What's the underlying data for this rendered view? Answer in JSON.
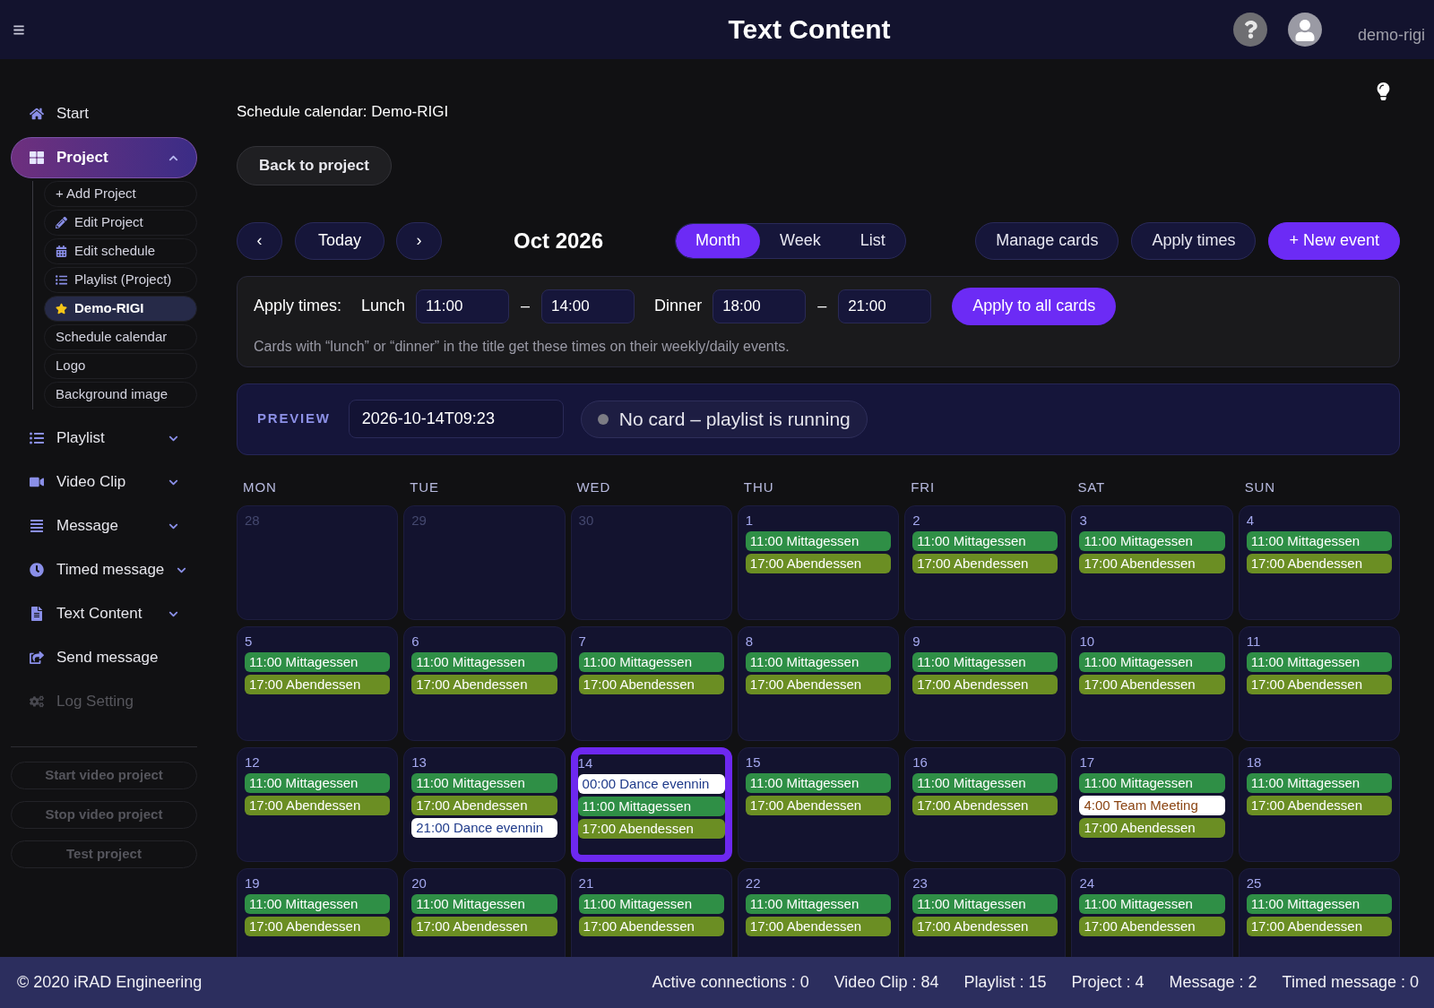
{
  "header": {
    "title": "Text Content",
    "username": "demo-rigi"
  },
  "sidebar": {
    "items": [
      {
        "label": "Start",
        "kind": "link",
        "selected": false,
        "disabled": false
      },
      {
        "label": "Project",
        "kind": "group",
        "selected": true,
        "expanded": true,
        "disabled": false,
        "children": [
          {
            "label": "+ Add Project",
            "selected": false
          },
          {
            "label": "Edit Project",
            "selected": false
          },
          {
            "label": "Edit schedule",
            "selected": false
          },
          {
            "label": "Playlist (Project)",
            "selected": false
          },
          {
            "label": "Demo-RIGI",
            "selected": true
          },
          {
            "label": "Schedule calendar",
            "selected": false
          },
          {
            "label": "Logo",
            "selected": false
          },
          {
            "label": "Background image",
            "selected": false
          }
        ]
      },
      {
        "label": "Playlist",
        "kind": "group",
        "selected": false,
        "expanded": false,
        "disabled": false
      },
      {
        "label": "Video Clip",
        "kind": "group",
        "selected": false,
        "expanded": false,
        "disabled": false
      },
      {
        "label": "Message",
        "kind": "group",
        "selected": false,
        "expanded": false,
        "disabled": false
      },
      {
        "label": "Timed message",
        "kind": "group",
        "selected": false,
        "expanded": false,
        "disabled": false
      },
      {
        "label": "Text Content",
        "kind": "group",
        "selected": false,
        "expanded": false,
        "disabled": false
      },
      {
        "label": "Send message",
        "kind": "link",
        "selected": false,
        "disabled": false
      },
      {
        "label": "Log Setting",
        "kind": "link",
        "selected": false,
        "disabled": true
      }
    ],
    "actions": [
      {
        "label": "Start video project",
        "disabled": true
      },
      {
        "label": "Stop video project",
        "disabled": true
      },
      {
        "label": "Test project",
        "disabled": true
      }
    ]
  },
  "breadcrumb": "Schedule calendar: Demo-RIGI",
  "back_button": "Back to project",
  "toolbar": {
    "prev": "‹",
    "today": "Today",
    "next": "›",
    "period": "Oct 2026",
    "views": [
      {
        "label": "Month",
        "selected": true
      },
      {
        "label": "Week",
        "selected": false
      },
      {
        "label": "List",
        "selected": false
      }
    ],
    "buttons": [
      {
        "label": "Manage cards",
        "kind": "secondary"
      },
      {
        "label": "Apply times",
        "kind": "secondary"
      },
      {
        "label": "+ New event",
        "kind": "primary"
      }
    ]
  },
  "apply_times": {
    "label": "Apply times:",
    "groups": [
      {
        "label": "Lunch",
        "from": "11:00",
        "separator": "–",
        "to": "14:00"
      },
      {
        "label": "Dinner",
        "from": "18:00",
        "separator": "–",
        "to": "21:00"
      }
    ],
    "button": "Apply to all cards",
    "note": "Cards with “lunch” or “dinner” in the title get these times on their weekly/daily events."
  },
  "preview": {
    "label": "PREVIEW",
    "datetime": "2026-10-14T09:23",
    "status": "No card – playlist is running"
  },
  "calendar": {
    "weekdays": [
      "MON",
      "TUE",
      "WED",
      "THU",
      "FRI",
      "SAT",
      "SUN"
    ],
    "weeks": [
      {
        "days": [
          {
            "date": "28",
            "outside_month": true,
            "today": false
          },
          {
            "date": "29",
            "outside_month": true,
            "today": false
          },
          {
            "date": "30",
            "outside_month": true,
            "today": false
          },
          {
            "date": "1",
            "outside_month": false,
            "today": false,
            "events": [
              {
                "label": "11:00 Mittagessen",
                "kind": "filled",
                "color": "#2f8f46"
              },
              {
                "label": "17:00 Abendessen",
                "kind": "filled",
                "color": "#6b8e23"
              }
            ]
          },
          {
            "date": "2",
            "outside_month": false,
            "today": false,
            "events": [
              {
                "label": "11:00 Mittagessen",
                "kind": "filled",
                "color": "#2f8f46"
              },
              {
                "label": "17:00 Abendessen",
                "kind": "filled",
                "color": "#6b8e23"
              }
            ]
          },
          {
            "date": "3",
            "outside_month": false,
            "today": false,
            "events": [
              {
                "label": "11:00 Mittagessen",
                "kind": "filled",
                "color": "#2f8f46"
              },
              {
                "label": "17:00 Abendessen",
                "kind": "filled",
                "color": "#6b8e23"
              }
            ]
          },
          {
            "date": "4",
            "outside_month": false,
            "today": false,
            "events": [
              {
                "label": "11:00 Mittagessen",
                "kind": "filled",
                "color": "#2f8f46"
              },
              {
                "label": "17:00 Abendessen",
                "kind": "filled",
                "color": "#6b8e23"
              }
            ]
          }
        ]
      },
      {
        "days": [
          {
            "date": "5",
            "outside_month": false,
            "today": false,
            "events": [
              {
                "label": "11:00 Mittagessen",
                "kind": "filled",
                "color": "#2f8f46"
              },
              {
                "label": "17:00 Abendessen",
                "kind": "filled",
                "color": "#6b8e23"
              }
            ]
          },
          {
            "date": "6",
            "outside_month": false,
            "today": false,
            "events": [
              {
                "label": "11:00 Mittagessen",
                "kind": "filled",
                "color": "#2f8f46"
              },
              {
                "label": "17:00 Abendessen",
                "kind": "filled",
                "color": "#6b8e23"
              }
            ]
          },
          {
            "date": "7",
            "outside_month": false,
            "today": false,
            "events": [
              {
                "label": "11:00 Mittagessen",
                "kind": "filled",
                "color": "#2f8f46"
              },
              {
                "label": "17:00 Abendessen",
                "kind": "filled",
                "color": "#6b8e23"
              }
            ]
          },
          {
            "date": "8",
            "outside_month": false,
            "today": false,
            "events": [
              {
                "label": "11:00 Mittagessen",
                "kind": "filled",
                "color": "#2f8f46"
              },
              {
                "label": "17:00 Abendessen",
                "kind": "filled",
                "color": "#6b8e23"
              }
            ]
          },
          {
            "date": "9",
            "outside_month": false,
            "today": false,
            "events": [
              {
                "label": "11:00 Mittagessen",
                "kind": "filled",
                "color": "#2f8f46"
              },
              {
                "label": "17:00 Abendessen",
                "kind": "filled",
                "color": "#6b8e23"
              }
            ]
          },
          {
            "date": "10",
            "outside_month": false,
            "today": false,
            "events": [
              {
                "label": "11:00 Mittagessen",
                "kind": "filled",
                "color": "#2f8f46"
              },
              {
                "label": "17:00 Abendessen",
                "kind": "filled",
                "color": "#6b8e23"
              }
            ]
          },
          {
            "date": "11",
            "outside_month": false,
            "today": false,
            "events": [
              {
                "label": "11:00 Mittagessen",
                "kind": "filled",
                "color": "#2f8f46"
              },
              {
                "label": "17:00 Abendessen",
                "kind": "filled",
                "color": "#6b8e23"
              }
            ]
          }
        ]
      },
      {
        "days": [
          {
            "date": "12",
            "outside_month": false,
            "today": false,
            "events": [
              {
                "label": "11:00 Mittagessen",
                "kind": "filled",
                "color": "#2f8f46"
              },
              {
                "label": "17:00 Abendessen",
                "kind": "filled",
                "color": "#6b8e23"
              }
            ]
          },
          {
            "date": "13",
            "outside_month": false,
            "today": false,
            "events": [
              {
                "label": "11:00 Mittagessen",
                "kind": "filled",
                "color": "#2f8f46"
              },
              {
                "label": "17:00 Abendessen",
                "kind": "filled",
                "color": "#6b8e23"
              },
              {
                "label": "21:00 Dance evennin",
                "kind": "light",
                "color": "#1e3a8a"
              }
            ]
          },
          {
            "date": "14",
            "outside_month": false,
            "today": true,
            "events": [
              {
                "label": "00:00 Dance evennin",
                "kind": "light",
                "color": "#1e3a8a"
              },
              {
                "label": "11:00 Mittagessen",
                "kind": "filled",
                "color": "#2f8f46"
              },
              {
                "label": "17:00 Abendessen",
                "kind": "filled",
                "color": "#6b8e23"
              }
            ]
          },
          {
            "date": "15",
            "outside_month": false,
            "today": false,
            "events": [
              {
                "label": "11:00 Mittagessen",
                "kind": "filled",
                "color": "#2f8f46"
              },
              {
                "label": "17:00 Abendessen",
                "kind": "filled",
                "color": "#6b8e23"
              }
            ]
          },
          {
            "date": "16",
            "outside_month": false,
            "today": false,
            "events": [
              {
                "label": "11:00 Mittagessen",
                "kind": "filled",
                "color": "#2f8f46"
              },
              {
                "label": "17:00 Abendessen",
                "kind": "filled",
                "color": "#6b8e23"
              }
            ]
          },
          {
            "date": "17",
            "outside_month": false,
            "today": false,
            "events": [
              {
                "label": "11:00 Mittagessen",
                "kind": "filled",
                "color": "#2f8f46"
              },
              {
                "label": "4:00 Team Meeting",
                "kind": "light",
                "color": "#8b4513"
              },
              {
                "label": "17:00 Abendessen",
                "kind": "filled",
                "color": "#6b8e23"
              }
            ]
          },
          {
            "date": "18",
            "outside_month": false,
            "today": false,
            "events": [
              {
                "label": "11:00 Mittagessen",
                "kind": "filled",
                "color": "#2f8f46"
              },
              {
                "label": "17:00 Abendessen",
                "kind": "filled",
                "color": "#6b8e23"
              }
            ]
          }
        ]
      },
      {
        "days": [
          {
            "date": "19",
            "outside_month": false,
            "today": false,
            "events": [
              {
                "label": "11:00 Mittagessen",
                "kind": "filled",
                "color": "#2f8f46"
              },
              {
                "label": "17:00 Abendessen",
                "kind": "filled",
                "color": "#6b8e23"
              }
            ]
          },
          {
            "date": "20",
            "outside_month": false,
            "today": false,
            "events": [
              {
                "label": "11:00 Mittagessen",
                "kind": "filled",
                "color": "#2f8f46"
              },
              {
                "label": "17:00 Abendessen",
                "kind": "filled",
                "color": "#6b8e23"
              }
            ]
          },
          {
            "date": "21",
            "outside_month": false,
            "today": false,
            "events": [
              {
                "label": "11:00 Mittagessen",
                "kind": "filled",
                "color": "#2f8f46"
              },
              {
                "label": "17:00 Abendessen",
                "kind": "filled",
                "color": "#6b8e23"
              }
            ]
          },
          {
            "date": "22",
            "outside_month": false,
            "today": false,
            "events": [
              {
                "label": "11:00 Mittagessen",
                "kind": "filled",
                "color": "#2f8f46"
              },
              {
                "label": "17:00 Abendessen",
                "kind": "filled",
                "color": "#6b8e23"
              }
            ]
          },
          {
            "date": "23",
            "outside_month": false,
            "today": false,
            "events": [
              {
                "label": "11:00 Mittagessen",
                "kind": "filled",
                "color": "#2f8f46"
              },
              {
                "label": "17:00 Abendessen",
                "kind": "filled",
                "color": "#6b8e23"
              }
            ]
          },
          {
            "date": "24",
            "outside_month": false,
            "today": false,
            "events": [
              {
                "label": "11:00 Mittagessen",
                "kind": "filled",
                "color": "#2f8f46"
              },
              {
                "label": "17:00 Abendessen",
                "kind": "filled",
                "color": "#6b8e23"
              }
            ]
          },
          {
            "date": "25",
            "outside_month": false,
            "today": false,
            "events": [
              {
                "label": "11:00 Mittagessen",
                "kind": "filled",
                "color": "#2f8f46"
              },
              {
                "label": "17:00 Abendessen",
                "kind": "filled",
                "color": "#6b8e23"
              }
            ]
          }
        ]
      }
    ]
  },
  "status_bar": {
    "copyright": "© 2020 iRAD Engineering",
    "stats": [
      "Active connections : 0",
      "Video Clip : 84",
      "Playlist : 15",
      "Project : 4",
      "Message : 2",
      "Timed message : 0"
    ]
  }
}
